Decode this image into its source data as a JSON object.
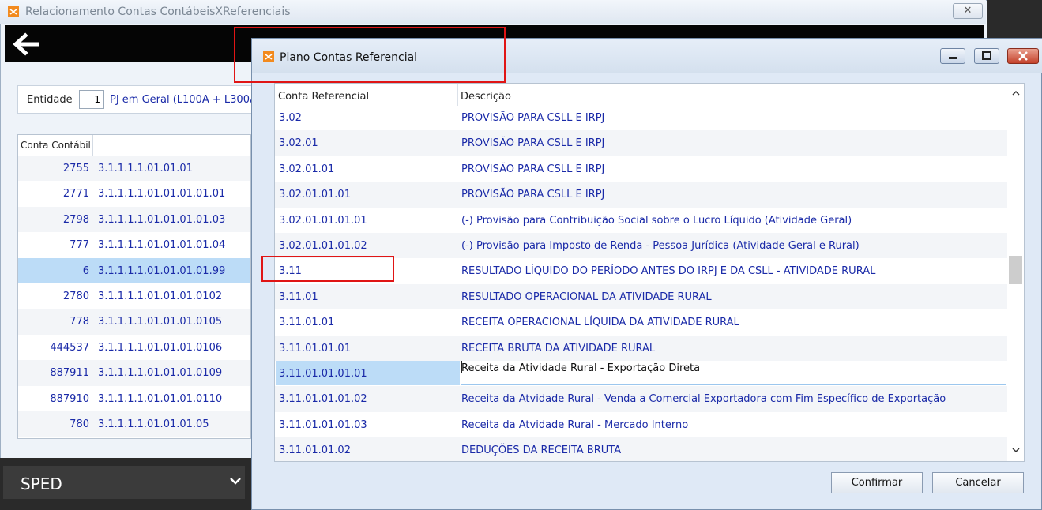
{
  "background_window": {
    "title": "Relacionamento Contas ContábeisXReferenciais",
    "close_label": "✕",
    "entity_label": "Entidade",
    "entity_value": "1",
    "entity_description": "PJ em Geral (L100A + L300A c",
    "table_header": "Conta Contábil",
    "rows": [
      {
        "num": "2755",
        "code": "3.1.1.1.1.01.01.01"
      },
      {
        "num": "2771",
        "code": "3.1.1.1.1.01.01.01.01.01"
      },
      {
        "num": "2798",
        "code": "3.1.1.1.1.01.01.01.01.03"
      },
      {
        "num": "777",
        "code": "3.1.1.1.1.01.01.01.01.04"
      },
      {
        "num": "6",
        "code": "3.1.1.1.1.01.01.01.01.99"
      },
      {
        "num": "2780",
        "code": "3.1.1.1.1.01.01.01.0102"
      },
      {
        "num": "778",
        "code": "3.1.1.1.1.01.01.01.0105"
      },
      {
        "num": "444537",
        "code": "3.1.1.1.1.01.01.01.0106"
      },
      {
        "num": "887911",
        "code": "3.1.1.1.1.01.01.01.0109"
      },
      {
        "num": "887910",
        "code": "3.1.1.1.1.01.01.01.0110"
      },
      {
        "num": "780",
        "code": "3.1.1.1.1.01.01.01.05"
      }
    ],
    "selected_row_index": 4,
    "footer_menu": "SPED"
  },
  "dialog": {
    "title": "Plano Contas Referencial",
    "header": {
      "conta": "Conta Referencial",
      "descricao": "Descrição"
    },
    "rows": [
      {
        "conta": "3.02",
        "descricao": "PROVISÃO PARA CSLL E IRPJ"
      },
      {
        "conta": "3.02.01",
        "descricao": "PROVISÃO PARA CSLL E IRPJ"
      },
      {
        "conta": "3.02.01.01",
        "descricao": "PROVISÃO PARA CSLL E IRPJ"
      },
      {
        "conta": "3.02.01.01.01",
        "descricao": "PROVISÃO PARA CSLL E IRPJ"
      },
      {
        "conta": "3.02.01.01.01.01",
        "descricao": "(-) Provisão para Contribuição Social sobre o Lucro Líquido (Atividade Geral)"
      },
      {
        "conta": "3.02.01.01.01.02",
        "descricao": "(-) Provisão para Imposto de Renda - Pessoa Jurídica (Atividade Geral e Rural)"
      },
      {
        "conta": "3.11",
        "descricao": "RESULTADO LÍQUIDO DO PERÍODO ANTES DO IRPJ E DA CSLL - ATIVIDADE RURAL"
      },
      {
        "conta": "3.11.01",
        "descricao": "RESULTADO OPERACIONAL DA ATIVIDADE RURAL"
      },
      {
        "conta": "3.11.01.01",
        "descricao": "RECEITA OPERACIONAL LÍQUIDA DA ATIVIDADE RURAL"
      },
      {
        "conta": "3.11.01.01.01",
        "descricao": "RECEITA BRUTA DA ATIVIDADE RURAL"
      },
      {
        "conta": "3.11.01.01.01.01",
        "descricao": "Receita da Atividade Rural - Exportação Direta"
      },
      {
        "conta": "3.11.01.01.01.02",
        "descricao": "Receita da Atvidade Rural - Venda a Comercial Exportadora com Fim Específico de Exportação"
      },
      {
        "conta": "3.11.01.01.01.03",
        "descricao": "Receita da Atvidade Rural - Mercado Interno"
      },
      {
        "conta": "3.11.01.01.02",
        "descricao": "DEDUÇÕES DA RECEITA BRUTA"
      }
    ],
    "selected_row_index": 10,
    "confirm_label": "Confirmar",
    "cancel_label": "Cancelar"
  },
  "colors": {
    "link_text": "#1a2aa8",
    "selection": "#bcdcf7",
    "annotation": "#e01515"
  }
}
